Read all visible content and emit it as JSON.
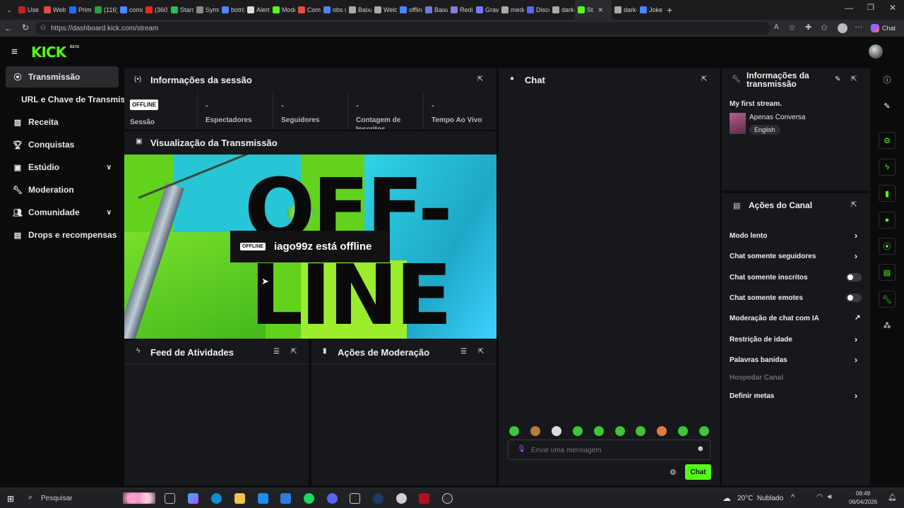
{
  "browser": {
    "tabs": [
      {
        "label": "Use O",
        "color": "#c5221f"
      },
      {
        "label": "Webm",
        "color": "#e04949"
      },
      {
        "label": "Prime",
        "color": "#1a6cff"
      },
      {
        "label": "(116)",
        "color": "#25a244"
      },
      {
        "label": "como",
        "color": "#4b87ff"
      },
      {
        "label": "(360)",
        "color": "#ff2020"
      },
      {
        "label": "Stars F",
        "color": "#2dbb52"
      },
      {
        "label": "Symm",
        "color": "#888"
      },
      {
        "label": "botrix",
        "color": "#4b87ff"
      },
      {
        "label": "Alerta",
        "color": "#ddd"
      },
      {
        "label": "Mode",
        "color": "#53fc18"
      },
      {
        "label": "Como",
        "color": "#e74c3c"
      },
      {
        "label": "obs st",
        "color": "#4b87ff"
      },
      {
        "label": "Baixar",
        "color": "#aaa"
      },
      {
        "label": "Welco",
        "color": "#aaa"
      },
      {
        "label": "offline",
        "color": "#4b87ff"
      },
      {
        "label": "Baixa",
        "color": "#6b7bd6"
      },
      {
        "label": "Redim",
        "color": "#8a7bd6"
      },
      {
        "label": "Grave",
        "color": "#7a7aff"
      },
      {
        "label": "medo",
        "color": "#aaa"
      },
      {
        "label": "Disco",
        "color": "#5865f2"
      },
      {
        "label": "dark-",
        "color": "#aaa"
      },
      {
        "label": "St",
        "color": "#53fc18"
      },
      {
        "label": "dark-",
        "color": "#aaa"
      },
      {
        "label": "Joker",
        "color": "#4b87ff"
      }
    ],
    "url": "https://dashboard.kick.com/stream",
    "chat_button": "Chat"
  },
  "header": {
    "logo": "KICK",
    "beta": "BETA"
  },
  "sidebar": {
    "items": [
      {
        "label": "Transmissão",
        "icon": "stream-icon"
      },
      {
        "label": "URL e Chave de Transmissão",
        "icon": ""
      },
      {
        "label": "Receita",
        "icon": "chart-icon"
      },
      {
        "label": "Conquistas",
        "icon": "trophy-icon"
      },
      {
        "label": "Estúdio",
        "icon": "studio-icon"
      },
      {
        "label": "Moderation",
        "icon": "wrench-icon"
      },
      {
        "label": "Comunidade",
        "icon": "community-icon"
      },
      {
        "label": "Drops e recompensas",
        "icon": "drops-icon"
      }
    ]
  },
  "session": {
    "title": "Informações da sessão",
    "status_badge": "OFFLINE",
    "stats": [
      {
        "value": "",
        "label": "Sessão"
      },
      {
        "value": "-",
        "label": "Espectadores"
      },
      {
        "value": "-",
        "label": "Seguidores"
      },
      {
        "value": "-",
        "label": "Contagem de Inscritos"
      },
      {
        "value": "-",
        "label": "Tempo Ao Vivo"
      }
    ]
  },
  "preview": {
    "title": "Visualização da Transmissão",
    "badge": "OFFLINE",
    "message": "iago99z está offline",
    "big_text_top": "OFF-",
    "big_text_bottom": "LINE"
  },
  "feed": {
    "title": "Feed de Atividades"
  },
  "mod_actions": {
    "title": "Ações de Moderação"
  },
  "chat": {
    "title": "Chat",
    "placeholder": "Envie uma mensagem",
    "send_label": "Chat",
    "emote_colors": [
      "#3fc43a",
      "#b77b3a",
      "#dcdcdc",
      "#3fc43a",
      "#3fc43a",
      "#3fc43a",
      "#3fc43a",
      "#e07f3a",
      "#3fc43a",
      "#3fc43a"
    ]
  },
  "stream_info": {
    "title": "Informações da transmissão",
    "stream_title": "My first stream.",
    "category": "Apenas Conversa",
    "language": "English"
  },
  "channel_actions": {
    "title": "Ações do Canal",
    "items": [
      {
        "label": "Modo lento",
        "control": "chevron"
      },
      {
        "label": "Chat somente seguidores",
        "control": "chevron"
      },
      {
        "label": "Chat somente inscritos",
        "control": "toggle",
        "enabled": false
      },
      {
        "label": "Chat somente emotes",
        "control": "toggle",
        "enabled": false
      },
      {
        "label": "Moderação de chat com IA",
        "control": "external"
      },
      {
        "label": "Restrição de idade",
        "control": "chevron"
      },
      {
        "label": "Palavras banidas",
        "control": "chevron"
      },
      {
        "label": "Hospedar Canal",
        "control": "none"
      },
      {
        "label": "Definir metas",
        "control": "chevron"
      }
    ]
  },
  "taskbar": {
    "search": "Pesquisar",
    "weather": "20°C  Nublado",
    "time": "08:49",
    "date": "06/04/2026"
  }
}
